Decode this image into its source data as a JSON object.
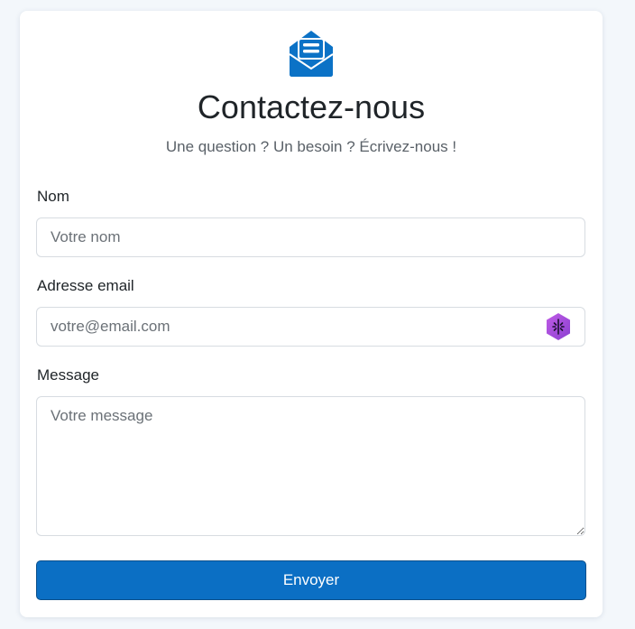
{
  "header": {
    "logo_icon": "envelope-open-text-icon",
    "title": "Contactez-nous",
    "subtitle": "Une question ? Un besoin ? Écrivez-nous !"
  },
  "form": {
    "name": {
      "label": "Nom",
      "placeholder": "Votre nom",
      "value": ""
    },
    "email": {
      "label": "Adresse email",
      "placeholder": "votre@email.com",
      "value": "",
      "extension_icon": "password-manager-icon"
    },
    "message": {
      "label": "Message",
      "placeholder": "Votre message",
      "value": ""
    },
    "submit_label": "Envoyer"
  },
  "colors": {
    "accent": "#0b6fc4",
    "extension_icon": "#a64ddb"
  }
}
